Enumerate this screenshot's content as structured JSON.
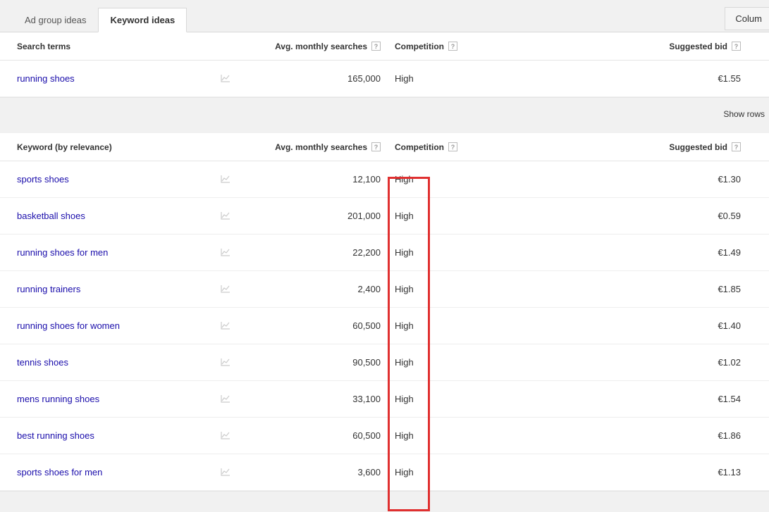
{
  "tabs": {
    "adgroup": "Ad group ideas",
    "keyword": "Keyword ideas"
  },
  "columns_button": "Colum",
  "headers": {
    "search_terms": "Search terms",
    "keyword": "Keyword (by relevance)",
    "avg_searches": "Avg. monthly searches",
    "competition": "Competition",
    "suggested_bid": "Suggested bid"
  },
  "search_term_row": {
    "term": "running shoes",
    "searches": "165,000",
    "competition": "High",
    "bid": "€1.55"
  },
  "show_rows": "Show rows",
  "keyword_rows": [
    {
      "term": "sports shoes",
      "searches": "12,100",
      "competition": "High",
      "bid": "€1.30"
    },
    {
      "term": "basketball shoes",
      "searches": "201,000",
      "competition": "High",
      "bid": "€0.59"
    },
    {
      "term": "running shoes for men",
      "searches": "22,200",
      "competition": "High",
      "bid": "€1.49"
    },
    {
      "term": "running trainers",
      "searches": "2,400",
      "competition": "High",
      "bid": "€1.85"
    },
    {
      "term": "running shoes for women",
      "searches": "60,500",
      "competition": "High",
      "bid": "€1.40"
    },
    {
      "term": "tennis shoes",
      "searches": "90,500",
      "competition": "High",
      "bid": "€1.02"
    },
    {
      "term": "mens running shoes",
      "searches": "33,100",
      "competition": "High",
      "bid": "€1.54"
    },
    {
      "term": "best running shoes",
      "searches": "60,500",
      "competition": "High",
      "bid": "€1.86"
    },
    {
      "term": "sports shoes for men",
      "searches": "3,600",
      "competition": "High",
      "bid": "€1.13"
    }
  ]
}
